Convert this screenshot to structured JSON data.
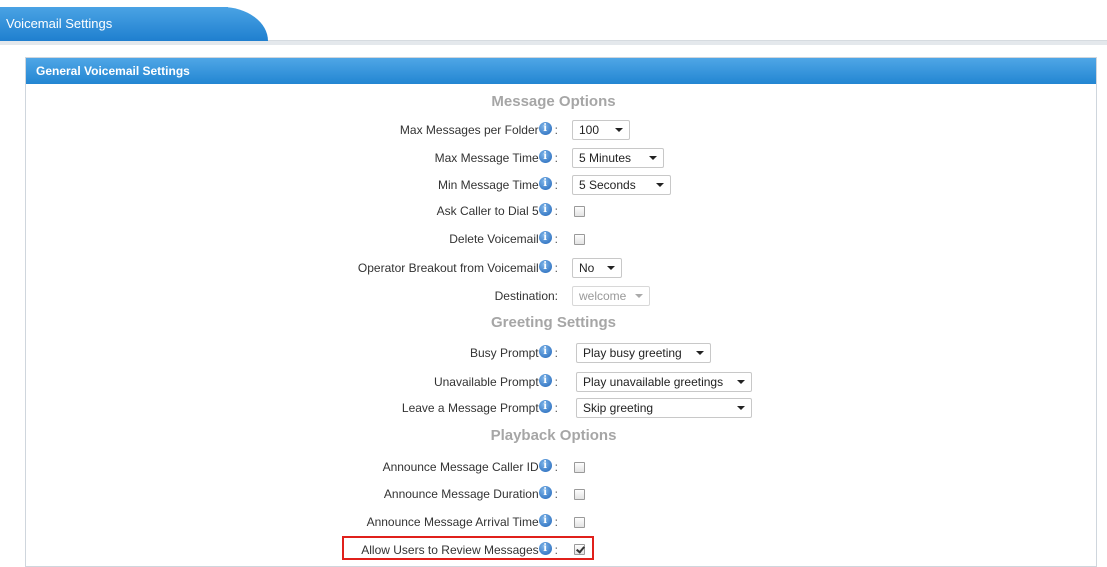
{
  "tab": {
    "label": "Voicemail Settings"
  },
  "panel": {
    "title": "General Voicemail Settings"
  },
  "sections": {
    "message_options": "Message Options",
    "greeting_settings": "Greeting Settings",
    "playback_options": "Playback Options"
  },
  "info_glyph": "i",
  "colon": ":",
  "message_options": {
    "max_messages": {
      "label": "Max Messages per Folder",
      "value": "100"
    },
    "max_message_time": {
      "label": "Max Message Time",
      "value": "5 Minutes"
    },
    "min_message_time": {
      "label": "Min Message Time",
      "value": "5 Seconds"
    },
    "ask_caller_dial5": {
      "label": "Ask Caller to Dial 5",
      "checked": false
    },
    "delete_voicemail": {
      "label": "Delete Voicemail",
      "checked": false
    },
    "operator_breakout": {
      "label": "Operator Breakout from Voicemail",
      "value": "No"
    },
    "destination": {
      "label": "Destination:",
      "value": "welcome"
    }
  },
  "greeting_settings": {
    "busy_prompt": {
      "label": "Busy Prompt",
      "value": "Play busy greeting"
    },
    "unavailable_prompt": {
      "label": "Unavailable Prompt",
      "value": "Play unavailable greetings"
    },
    "leave_message_prompt": {
      "label": "Leave a Message Prompt",
      "value": "Skip greeting"
    }
  },
  "playback_options": {
    "announce_caller_id": {
      "label": "Announce Message Caller ID",
      "checked": false
    },
    "announce_duration": {
      "label": "Announce Message Duration",
      "checked": false
    },
    "announce_arrival_time": {
      "label": "Announce Message Arrival Time",
      "checked": false
    },
    "allow_review": {
      "label": "Allow Users to Review Messages",
      "checked": true
    }
  },
  "colors": {
    "tab_blue": "#2386d2",
    "section_title_gray": "#a6a6a6",
    "highlight_red": "#e0201b"
  }
}
